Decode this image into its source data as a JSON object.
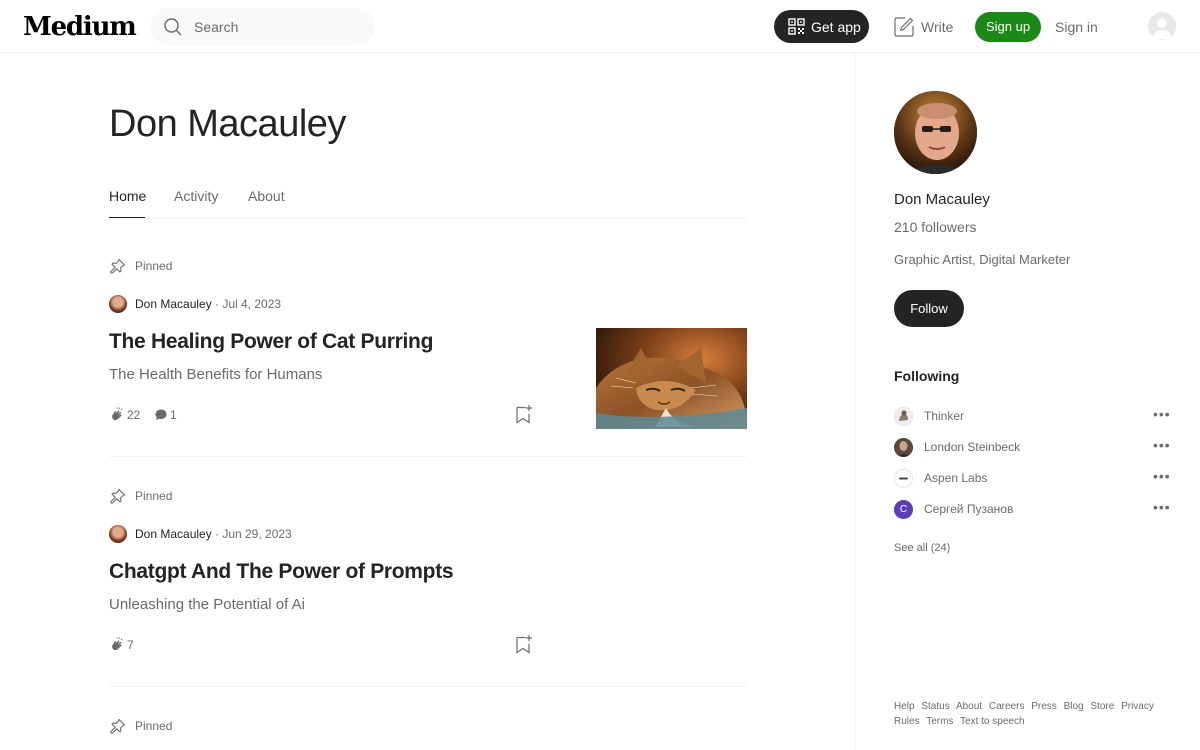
{
  "header": {
    "logo": "Medium",
    "search_placeholder": "Search",
    "get_app_label": "Get app",
    "write_label": "Write",
    "signup_label": "Sign up",
    "signin_label": "Sign in"
  },
  "profile": {
    "name": "Don Macauley",
    "tabs": [
      {
        "label": "Home",
        "active": true
      },
      {
        "label": "Activity",
        "active": false
      },
      {
        "label": "About",
        "active": false
      }
    ]
  },
  "posts": [
    {
      "pinned_label": "Pinned",
      "author": "Don Macauley",
      "date": "· Jul 4, 2023",
      "title": "The Healing Power of Cat Purring",
      "subtitle": "The Health Benefits for Humans",
      "claps": "22",
      "responses": "1",
      "has_image": true
    },
    {
      "pinned_label": "Pinned",
      "author": "Don Macauley",
      "date": "· Jun 29, 2023",
      "title": "Chatgpt And The Power of Prompts",
      "subtitle": "Unleashing the Potential of Ai",
      "claps": "7",
      "responses": "",
      "has_image": false
    },
    {
      "pinned_label": "Pinned"
    }
  ],
  "sidebar": {
    "name": "Don Macauley",
    "followers": "210 followers",
    "bio": "Graphic Artist, Digital Marketer",
    "follow_label": "Follow",
    "following_heading": "Following",
    "following": [
      {
        "name": "Thinker",
        "avatar_color": "#c9b9ad"
      },
      {
        "name": "London Steinbeck",
        "avatar_color": "#6e5a48"
      },
      {
        "name": "Aspen Labs",
        "avatar_color": "#ffffff"
      },
      {
        "name": "Сергей Пузанов",
        "avatar_color": "#5b3db5",
        "initial": "С"
      }
    ],
    "more_label": "•••",
    "see_all": "See all (24)",
    "footer_links": [
      "Help",
      "Status",
      "About",
      "Careers",
      "Press",
      "Blog",
      "Store",
      "Privacy",
      "Rules",
      "Terms",
      "Text to speech"
    ]
  },
  "colors": {
    "accent_green": "#1a8917",
    "text_primary": "#242424",
    "text_secondary": "#6b6b6b"
  }
}
